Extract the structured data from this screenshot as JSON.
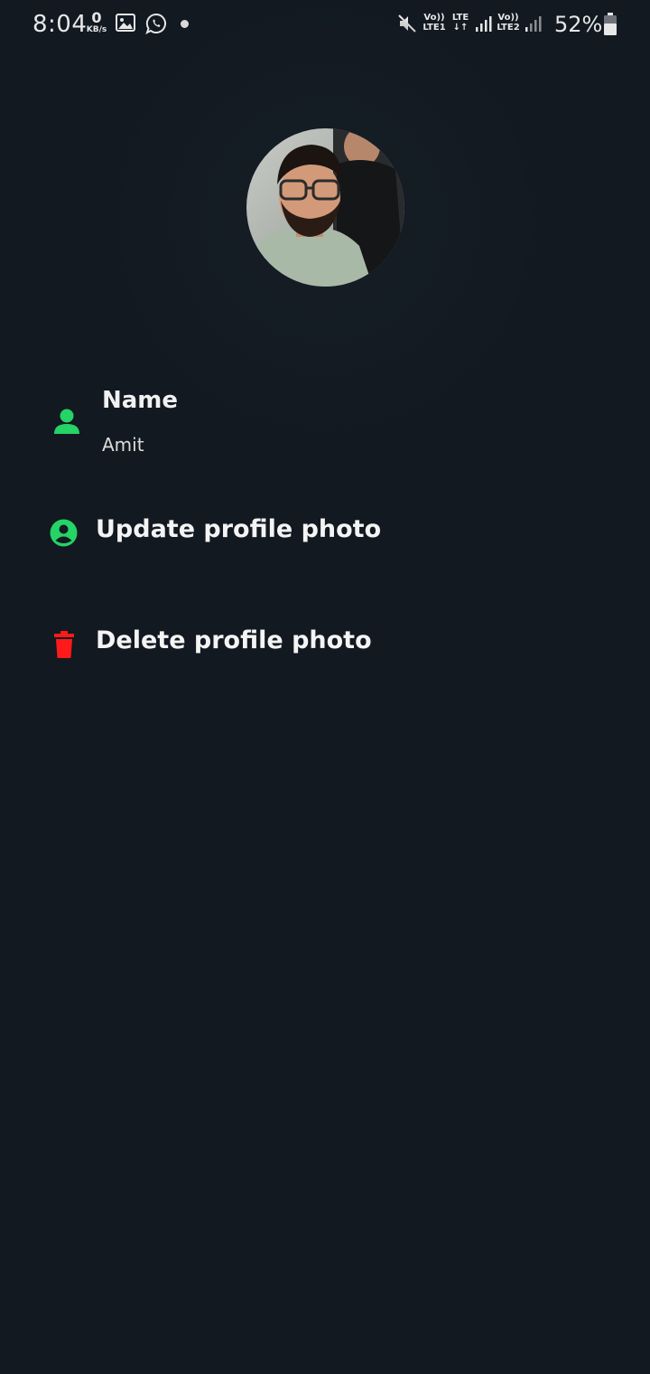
{
  "status_bar": {
    "time": "8:04",
    "data_speed_value": "0",
    "data_speed_unit": "KB/s",
    "sim1_top": "Vo))",
    "sim1_bottom": "LTE1",
    "lte_top": "LTE",
    "lte_bottom": "↓↑",
    "sim2_top": "Vo))",
    "sim2_bottom": "LTE2",
    "battery_percent": "52%",
    "icons": [
      "gallery-icon",
      "whatsapp-icon",
      "notification-dot",
      "mute-icon",
      "signal-icon",
      "battery-icon"
    ]
  },
  "profile": {
    "name_title": "Name",
    "name_value": "Amit"
  },
  "actions": {
    "update_label": "Update profile photo",
    "delete_label": "Delete profile photo"
  },
  "colors": {
    "background": "#121921",
    "accent_green": "#25d366",
    "delete_red": "#ff1a1a"
  }
}
